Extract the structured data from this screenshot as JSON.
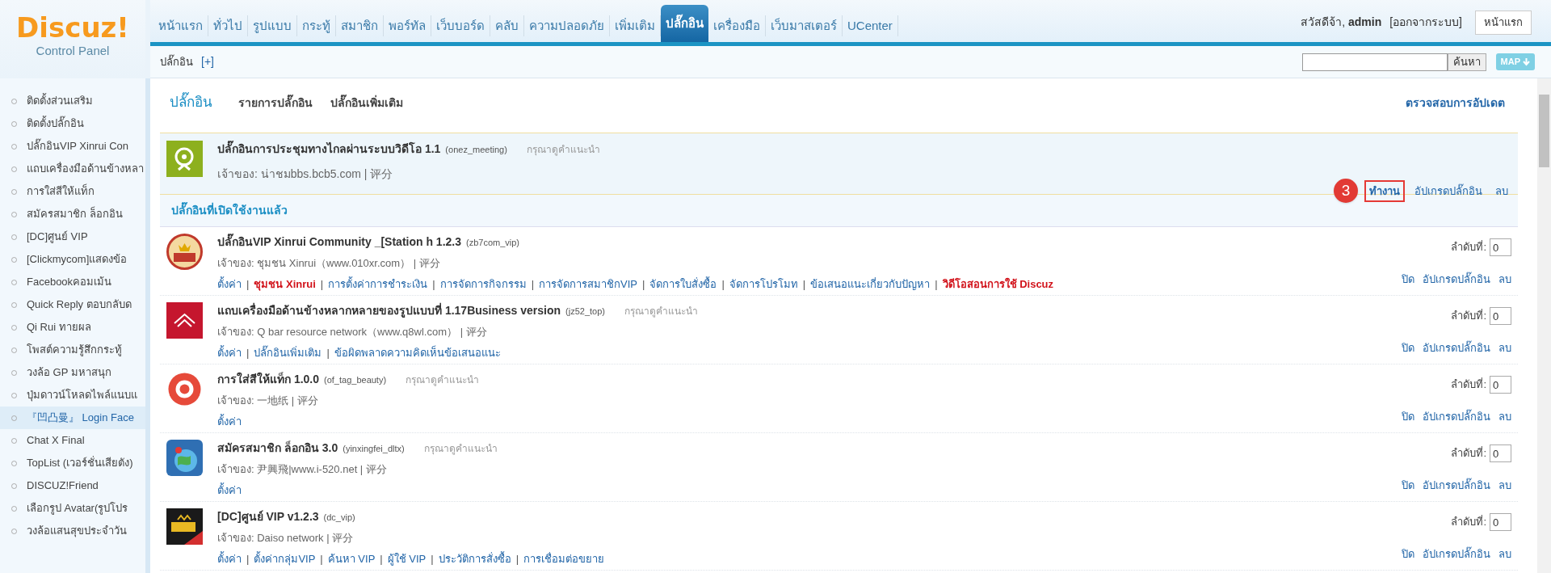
{
  "logo": {
    "title": "Discuz!",
    "subtitle": "Control Panel"
  },
  "nav": [
    {
      "label": "หน้าแรก",
      "selected": false
    },
    {
      "label": "ทั่วไป",
      "selected": false
    },
    {
      "label": "รูปแบบ",
      "selected": false
    },
    {
      "label": "กระทู้",
      "selected": false
    },
    {
      "label": "สมาชิก",
      "selected": false
    },
    {
      "label": "พอร์ทัล",
      "selected": false
    },
    {
      "label": "เว็บบอร์ด",
      "selected": false
    },
    {
      "label": "คลับ",
      "selected": false
    },
    {
      "label": "ความปลอดภัย",
      "selected": false
    },
    {
      "label": "เพิ่มเติม",
      "selected": false
    },
    {
      "label": "ปลั๊กอิน",
      "selected": true
    },
    {
      "label": "เครื่องมือ",
      "selected": false
    },
    {
      "label": "เว็บมาสเตอร์",
      "selected": false
    },
    {
      "label": "UCenter",
      "selected": false
    }
  ],
  "user": {
    "greeting": "สวัสดีจ้า,",
    "name": "admin",
    "logout": "[ออกจากระบบ]",
    "home_button": "หน้าแรก"
  },
  "subbar": {
    "title": "ปลั๊กอิน",
    "add": "[+]",
    "search_button": "ค้นหา",
    "map_button": "MAP"
  },
  "sidebar": [
    {
      "label": "ติดตั้งส่วนเสริม",
      "selected": false
    },
    {
      "label": "ติดตั้งปลั๊กอิน",
      "selected": false
    },
    {
      "label": "ปลั๊กอินVIP Xinrui Con",
      "selected": false
    },
    {
      "label": "แถบเครื่องมือด้านข้างหลา",
      "selected": false
    },
    {
      "label": "การใส่สีให้แท็ก",
      "selected": false
    },
    {
      "label": "สมัครสมาชิก ล็อกอิน",
      "selected": false
    },
    {
      "label": "[DC]ศูนย์ VIP",
      "selected": false
    },
    {
      "label": "[Clickmycom]แสดงข้อ",
      "selected": false
    },
    {
      "label": "Facebookคอมเม้น",
      "selected": false
    },
    {
      "label": "Quick Reply ตอบกลับด",
      "selected": false
    },
    {
      "label": "Qi Rui ทายผล",
      "selected": false
    },
    {
      "label": "โพสต์ความรู้สึกกระทู้",
      "selected": false
    },
    {
      "label": "วงล้อ GP มหาสนุก",
      "selected": false
    },
    {
      "label": "ปุ่มดาวน์โหลดไพล์แนบแ",
      "selected": false
    },
    {
      "label": "『凹凸曼』 Login Face",
      "selected": true
    },
    {
      "label": "Chat X Final",
      "selected": false
    },
    {
      "label": "TopList (เวอร์ชั่นเสียตัง)",
      "selected": false
    },
    {
      "label": "DISCUZ!Friend",
      "selected": false
    },
    {
      "label": "เลือกรูป Avatar(รูปโปร",
      "selected": false
    },
    {
      "label": "วงล้อแสนสุขประจำวัน",
      "selected": false
    }
  ],
  "page_tabs": [
    {
      "label": "ปลั๊กอิน",
      "selected": true
    },
    {
      "label": "รายการปลั๊กอิน",
      "selected": false
    },
    {
      "label": "ปลั๊กอินเพิ่มเติม",
      "selected": false
    }
  ],
  "check_updates": "ตรวจสอบการอัปเดต",
  "separator": "|",
  "disabled_plugins": [
    {
      "title": "ปลั๊กอินการประชุมทางไกลผ่านระบบวิดีโอ 1.1",
      "id": "(onez_meeting)",
      "hint": "กรุณาดูคำแนะนำ",
      "owner": "เจ้าของ: น่าชมbbs.bcb5.com | 评分",
      "actions": [
        {
          "label": "ทำงาน",
          "highlighted": true,
          "callout": "3"
        },
        {
          "label": "อัปเกรดปลั๊กอิน",
          "highlighted": false
        },
        {
          "label": "ลบ",
          "highlighted": false
        }
      ]
    }
  ],
  "enabled_heading": "ปลั๊กอินที่เปิดใช้งานแล้ว",
  "enabled_plugins": [
    {
      "title": "ปลั๊กอินVIP Xinrui Community _[Station h 1.2.3",
      "id": "(zb7com_vip)",
      "owner": "เจ้าของ: ชุมชน Xinrui（www.010xr.com） | 评分",
      "order_label": "ลำดับที่:",
      "order": "0",
      "links": [
        {
          "label": "ตั้งค่า",
          "emphasis": false
        },
        {
          "label": "ชุมชน Xinrui",
          "emphasis": true
        },
        {
          "label": "การตั้งค่าการชำระเงิน",
          "emphasis": false
        },
        {
          "label": "การจัดการกิจกรรม",
          "emphasis": false
        },
        {
          "label": "การจัดการสมาชิกVIP",
          "emphasis": false
        },
        {
          "label": "จัดการใบสั่งซื้อ",
          "emphasis": false
        },
        {
          "label": "จัดการโปรโมท",
          "emphasis": false
        },
        {
          "label": "ข้อเสนอแนะเกี่ยวกับปัญหา",
          "emphasis": false
        },
        {
          "label": "วิดีโอสอนการใช้ Discuz",
          "emphasis": true
        }
      ],
      "actions": [
        "ปิด",
        "อัปเกรดปลั๊กอิน",
        "ลบ"
      ]
    },
    {
      "title": "แถบเครื่องมือด้านข้างหลากหลายของรูปแบบที่ 1.17Business version",
      "id": "(jz52_top)",
      "hint": "กรุณาดูคำแนะนำ",
      "owner": "เจ้าของ: Q bar resource network（www.q8wl.com） | 评分",
      "order_label": "ลำดับที่:",
      "order": "0",
      "links": [
        {
          "label": "ตั้งค่า",
          "emphasis": false
        },
        {
          "label": "ปลั๊กอินเพิ่มเติม",
          "emphasis": false
        },
        {
          "label": "ข้อผิดพลาดความคิดเห็นข้อเสนอแนะ",
          "emphasis": false
        }
      ],
      "actions": [
        "ปิด",
        "อัปเกรดปลั๊กอิน",
        "ลบ"
      ]
    },
    {
      "title": "การใส่สีให้แท็ก 1.0.0",
      "id": "(of_tag_beauty)",
      "hint": "กรุณาดูคำแนะนำ",
      "owner": "เจ้าของ: 一地纸 | 评分",
      "order_label": "ลำดับที่:",
      "order": "0",
      "links": [
        {
          "label": "ตั้งค่า",
          "emphasis": false
        }
      ],
      "actions": [
        "ปิด",
        "อัปเกรดปลั๊กอิน",
        "ลบ"
      ]
    },
    {
      "title": "สมัครสมาชิก ล็อกอิน 3.0",
      "id": "(yinxingfei_dltx)",
      "hint": "กรุณาดูคำแนะนำ",
      "owner": "เจ้าของ: 尹興飛|www.i-520.net | 评分",
      "order_label": "ลำดับที่:",
      "order": "0",
      "links": [
        {
          "label": "ตั้งค่า",
          "emphasis": false
        }
      ],
      "actions": [
        "ปิด",
        "อัปเกรดปลั๊กอิน",
        "ลบ"
      ]
    },
    {
      "title": "[DC]ศูนย์ VIP v1.2.3",
      "id": "(dc_vip)",
      "owner": "เจ้าของ: Daiso network | 评分",
      "order_label": "ลำดับที่:",
      "order": "0",
      "links": [
        {
          "label": "ตั้งค่า",
          "emphasis": false
        },
        {
          "label": "ตั้งค่ากลุ่มVIP",
          "emphasis": false
        },
        {
          "label": "ค้นหา VIP",
          "emphasis": false
        },
        {
          "label": "ผู้ใช้ VIP",
          "emphasis": false
        },
        {
          "label": "ประวัติการสั่งซื้อ",
          "emphasis": false
        },
        {
          "label": "การเชื่อมต่อขยาย",
          "emphasis": false
        }
      ],
      "actions": [
        "ปิด",
        "อัปเกรดปลั๊กอิน",
        "ลบ"
      ]
    }
  ]
}
